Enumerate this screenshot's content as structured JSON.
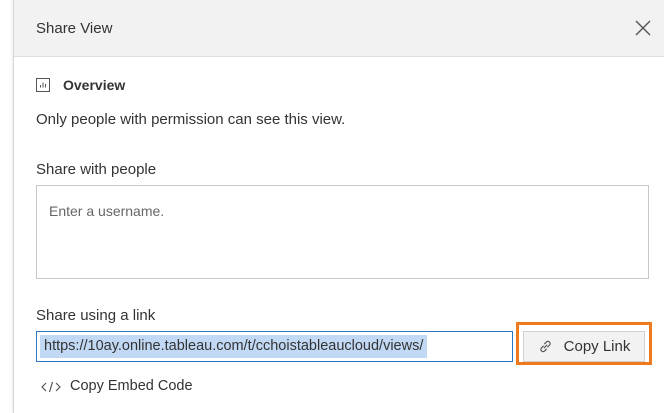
{
  "dialog": {
    "title": "Share View",
    "close_icon": "close-icon"
  },
  "view": {
    "icon": "view-sheet-icon",
    "name": "Overview",
    "permission_note": "Only people with permission can see this view."
  },
  "share_people": {
    "label": "Share with people",
    "placeholder": "Enter a username.",
    "value": ""
  },
  "share_link": {
    "label": "Share using a link",
    "url": "https://10ay.online.tableau.com/t/cchoistableaucloud/views/",
    "copy_button_label": "Copy Link",
    "copy_icon": "link-icon",
    "highlight_color": "#ee7a1d"
  },
  "embed": {
    "icon": "code-icon",
    "label": "Copy Embed Code"
  },
  "colors": {
    "header_bg": "#f2f2f2",
    "link_selection": "#c2d9f5",
    "focus_border": "#2d78c6"
  }
}
